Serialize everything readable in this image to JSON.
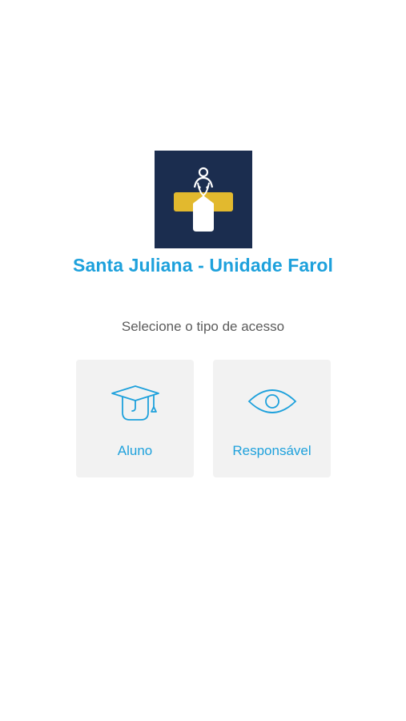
{
  "school": {
    "name": "Santa Juliana - Unidade Farol"
  },
  "access": {
    "prompt": "Selecione o tipo de acesso",
    "options": [
      {
        "label": "Aluno",
        "icon": "graduation-cap-icon"
      },
      {
        "label": "Responsável",
        "icon": "eye-icon"
      }
    ]
  },
  "colors": {
    "accent": "#1ea1dc",
    "logo_background": "#1b2d4f",
    "logo_cross": "#e2b92e",
    "card_background": "#f2f2f2"
  }
}
